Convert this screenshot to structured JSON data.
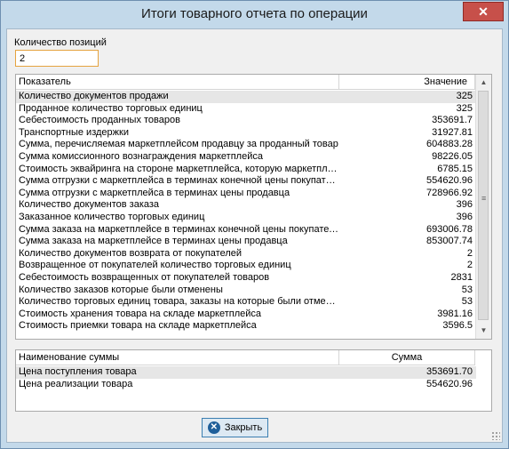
{
  "window": {
    "title": "Итоги товарного отчета по операции",
    "close_symbol": "✕"
  },
  "count": {
    "label": "Количество позиций",
    "value": "2"
  },
  "main_table": {
    "columns": [
      "Показатель",
      "Значение"
    ],
    "rows": [
      {
        "name": "Количество документов продажи",
        "value": "325"
      },
      {
        "name": "Проданное количество торговых единиц",
        "value": "325"
      },
      {
        "name": "Себестоимость проданных товаров",
        "value": "353691.7"
      },
      {
        "name": "Транспортные издержки",
        "value": "31927.81"
      },
      {
        "name": "Сумма, перечисляемая маркетплейсом продавцу за проданный товар",
        "value": "604883.28"
      },
      {
        "name": "Сумма комиссионного вознаграждения маркетплейса",
        "value": "98226.05"
      },
      {
        "name": "Стоимость эквайринга на стороне маркетплейса, которую маркетплейс удерживает",
        "value": "6785.15"
      },
      {
        "name": "Сумма отгрузки с маркетплейса в терминах конечной цены покупателя",
        "value": "554620.96"
      },
      {
        "name": "Сумма отгрузки с маркетплейса в терминах цены продавца",
        "value": "728966.92"
      },
      {
        "name": "Количество документов заказа",
        "value": "396"
      },
      {
        "name": "Заказанное количество торговых единиц",
        "value": "396"
      },
      {
        "name": "Сумма заказа на маркетплейсе в терминах конечной цены покупателя",
        "value": "693006.78"
      },
      {
        "name": "Сумма заказа на маркетплейсе в терминах цены продавца",
        "value": "853007.74"
      },
      {
        "name": "Количество документов возврата от покупателей",
        "value": "2"
      },
      {
        "name": "Возвращенное от покупателей количество торговых единиц",
        "value": "2"
      },
      {
        "name": "Себестоимость возвращенных от покупателей товаров",
        "value": "2831"
      },
      {
        "name": "Количество заказов которые были отменены",
        "value": "53"
      },
      {
        "name": "Количество торговых единиц товара, заказы на которые были отменены",
        "value": "53"
      },
      {
        "name": "Стоимость хранения товара на складе маркетплейса",
        "value": "3981.16"
      },
      {
        "name": "Стоимость приемки товара на складе маркетплейса",
        "value": "3596.5"
      }
    ]
  },
  "sums_table": {
    "columns": [
      "Наименование суммы",
      "Сумма"
    ],
    "rows": [
      {
        "name": "Цена поступления товара",
        "value": "353691.70"
      },
      {
        "name": "Цена реализации товара",
        "value": "554620.96"
      }
    ]
  },
  "buttons": {
    "close_label": "Закрыть"
  }
}
